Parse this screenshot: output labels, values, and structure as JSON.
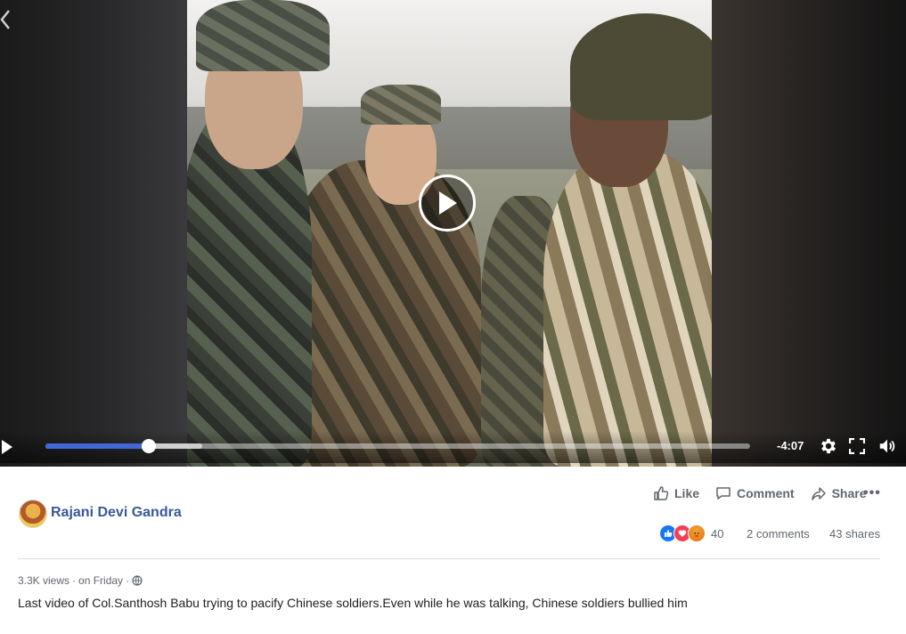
{
  "video": {
    "time_remaining": "-4:07",
    "progress_played": 0.147,
    "progress_buffered": 0.223,
    "state": "paused"
  },
  "post": {
    "author": "Rajani Devi Gandra",
    "actions": {
      "like": "Like",
      "comment": "Comment",
      "share": "Share"
    },
    "reactions": {
      "types": [
        "like-icon",
        "love-icon",
        "angry-icon"
      ],
      "count": "40"
    },
    "comments": "2 comments",
    "shares": "43 shares",
    "views": "3.3K views",
    "posted": "on Friday",
    "audience": "globe-icon",
    "caption": "Last video of Col.Santhosh Babu trying to pacify Chinese soldiers.Even while he was talking, Chinese soldiers bullied him"
  },
  "colors": {
    "progress": "#4267d8",
    "author_link": "#385898",
    "like_reaction": "#1877f2",
    "love_reaction": "#f33e58",
    "angry_reaction": "#e9710f"
  }
}
